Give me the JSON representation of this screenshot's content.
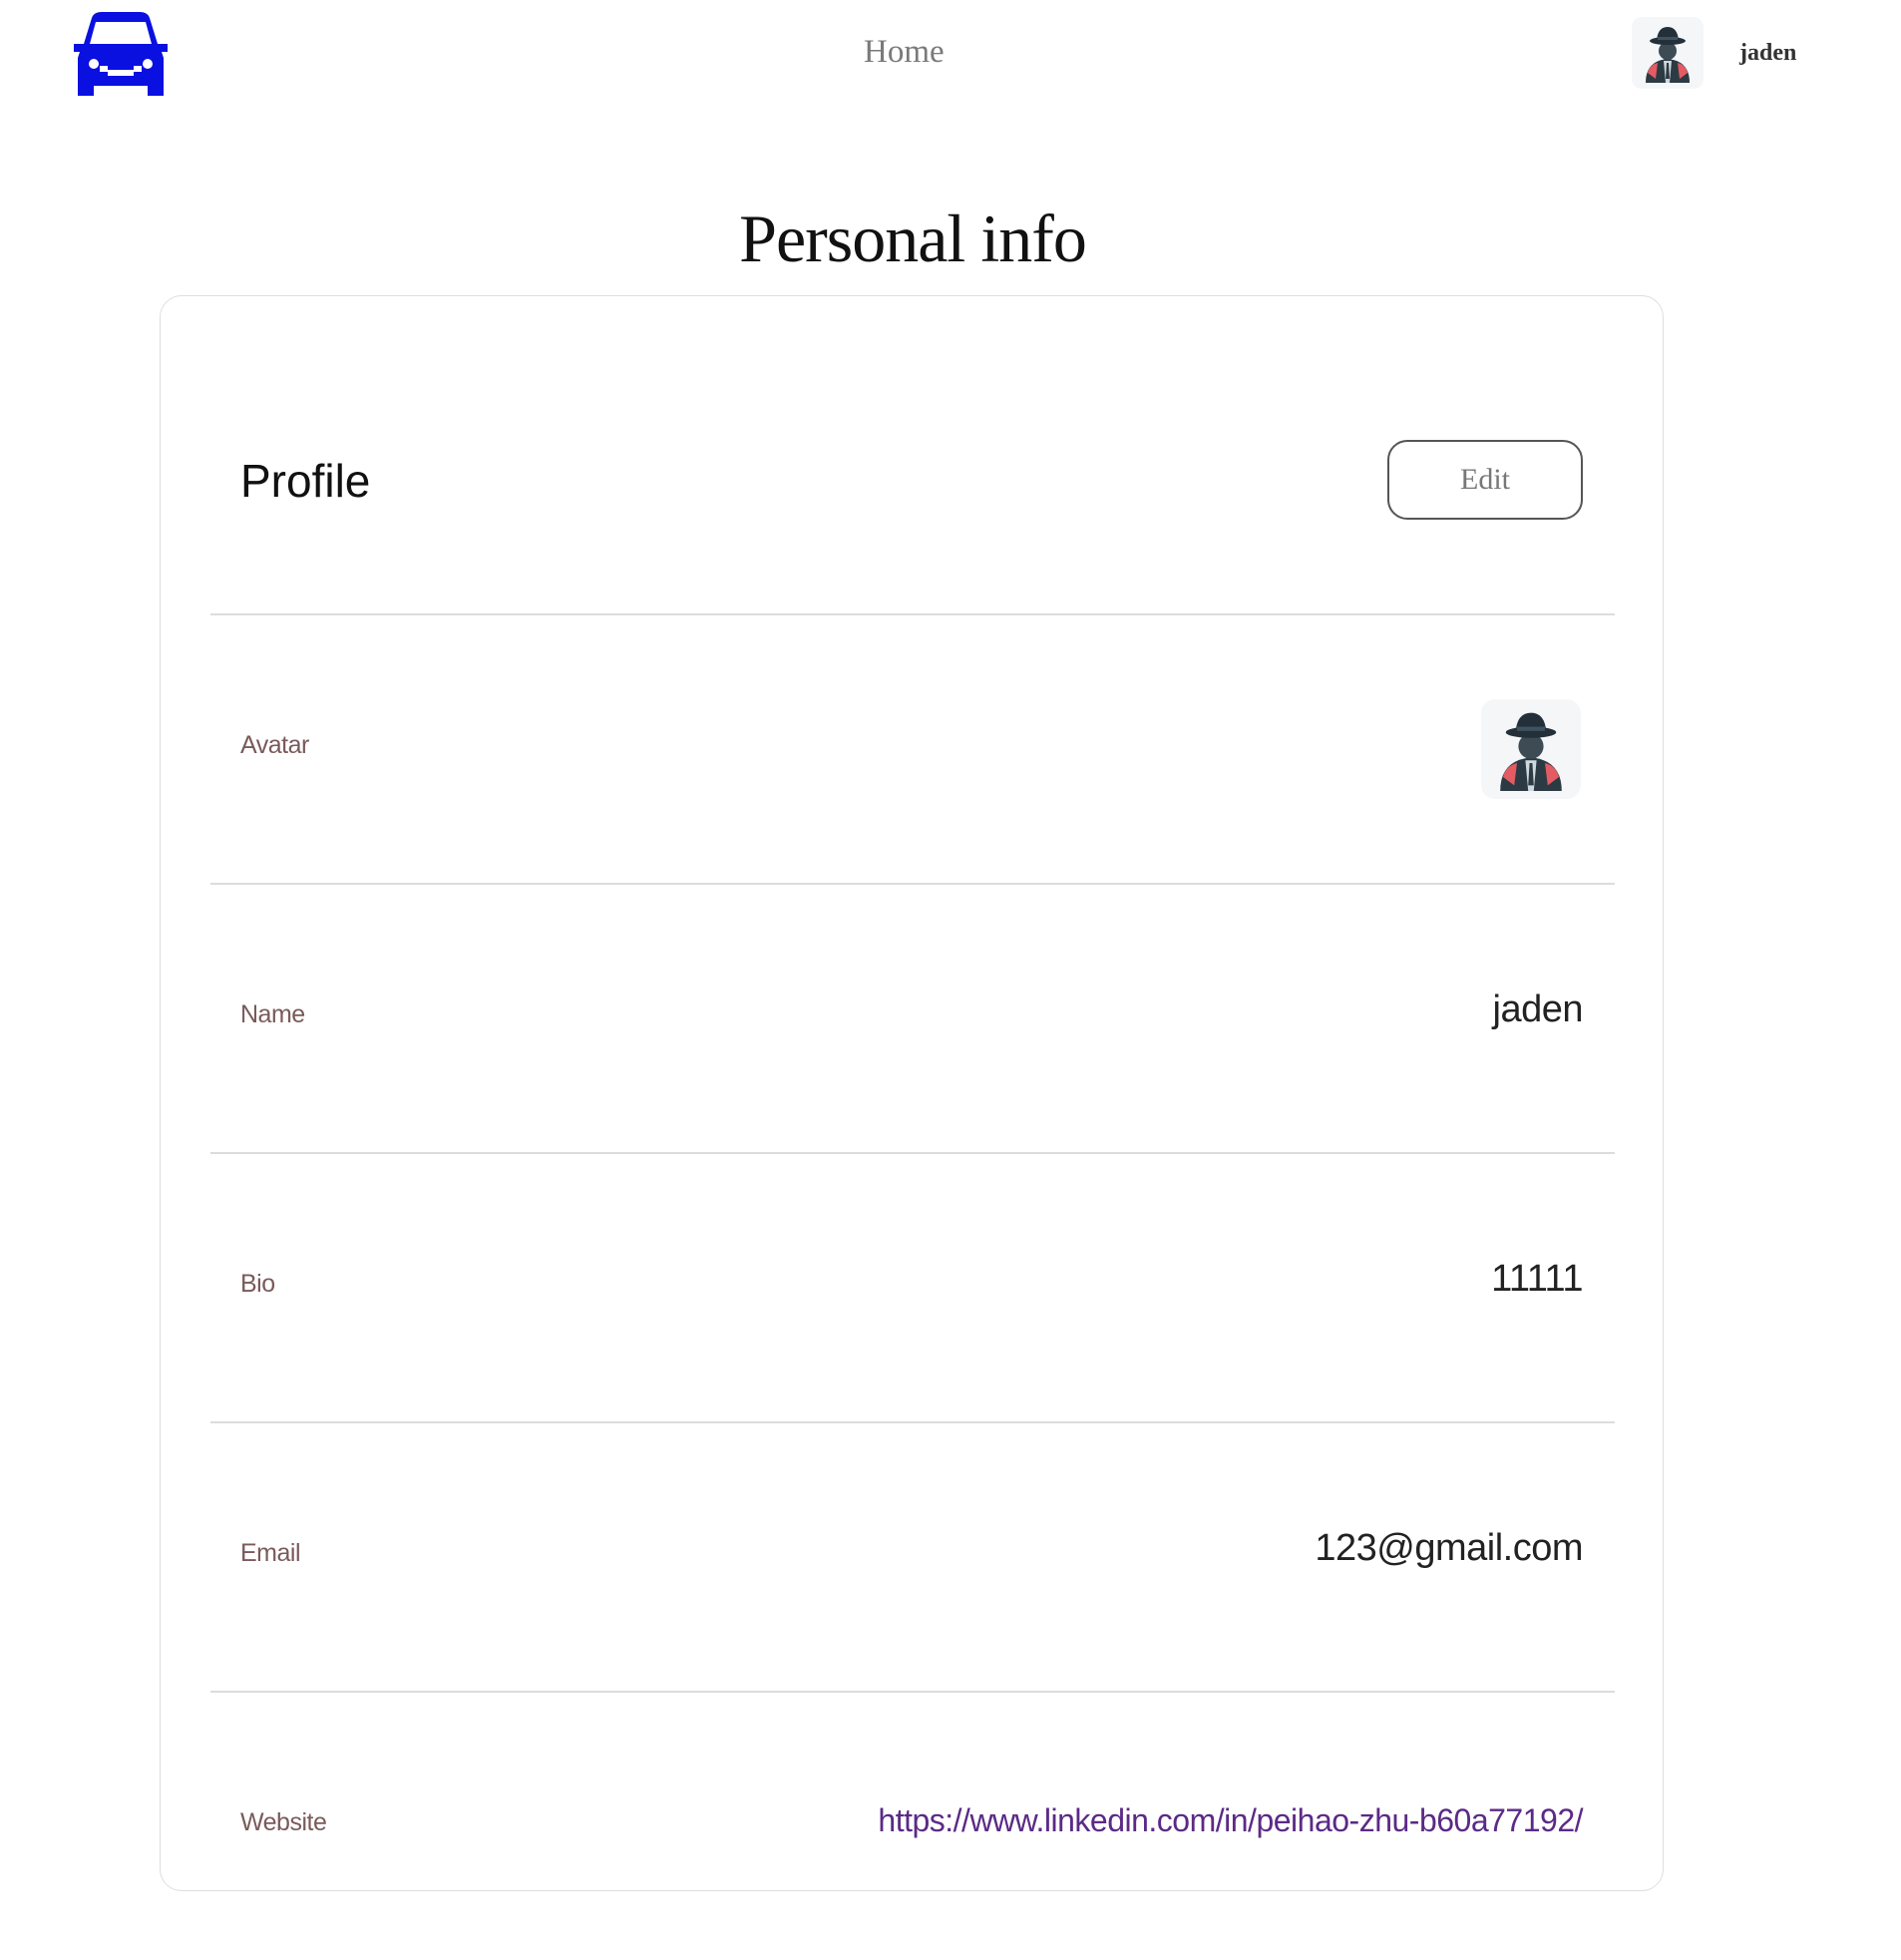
{
  "header": {
    "nav_home": "Home",
    "user_name": "jaden",
    "brand_color": "#0a10e0"
  },
  "page": {
    "title": "Personal info"
  },
  "profile": {
    "title": "Profile",
    "edit_label": "Edit",
    "fields": [
      {
        "label": "Avatar",
        "value": ""
      },
      {
        "label": "Name",
        "value": "jaden"
      },
      {
        "label": "Bio",
        "value": "11111"
      },
      {
        "label": "Email",
        "value": "123@gmail.com"
      },
      {
        "label": "Website",
        "value": "https://www.linkedin.com/in/peihao-zhu-b60a77192/"
      }
    ]
  }
}
